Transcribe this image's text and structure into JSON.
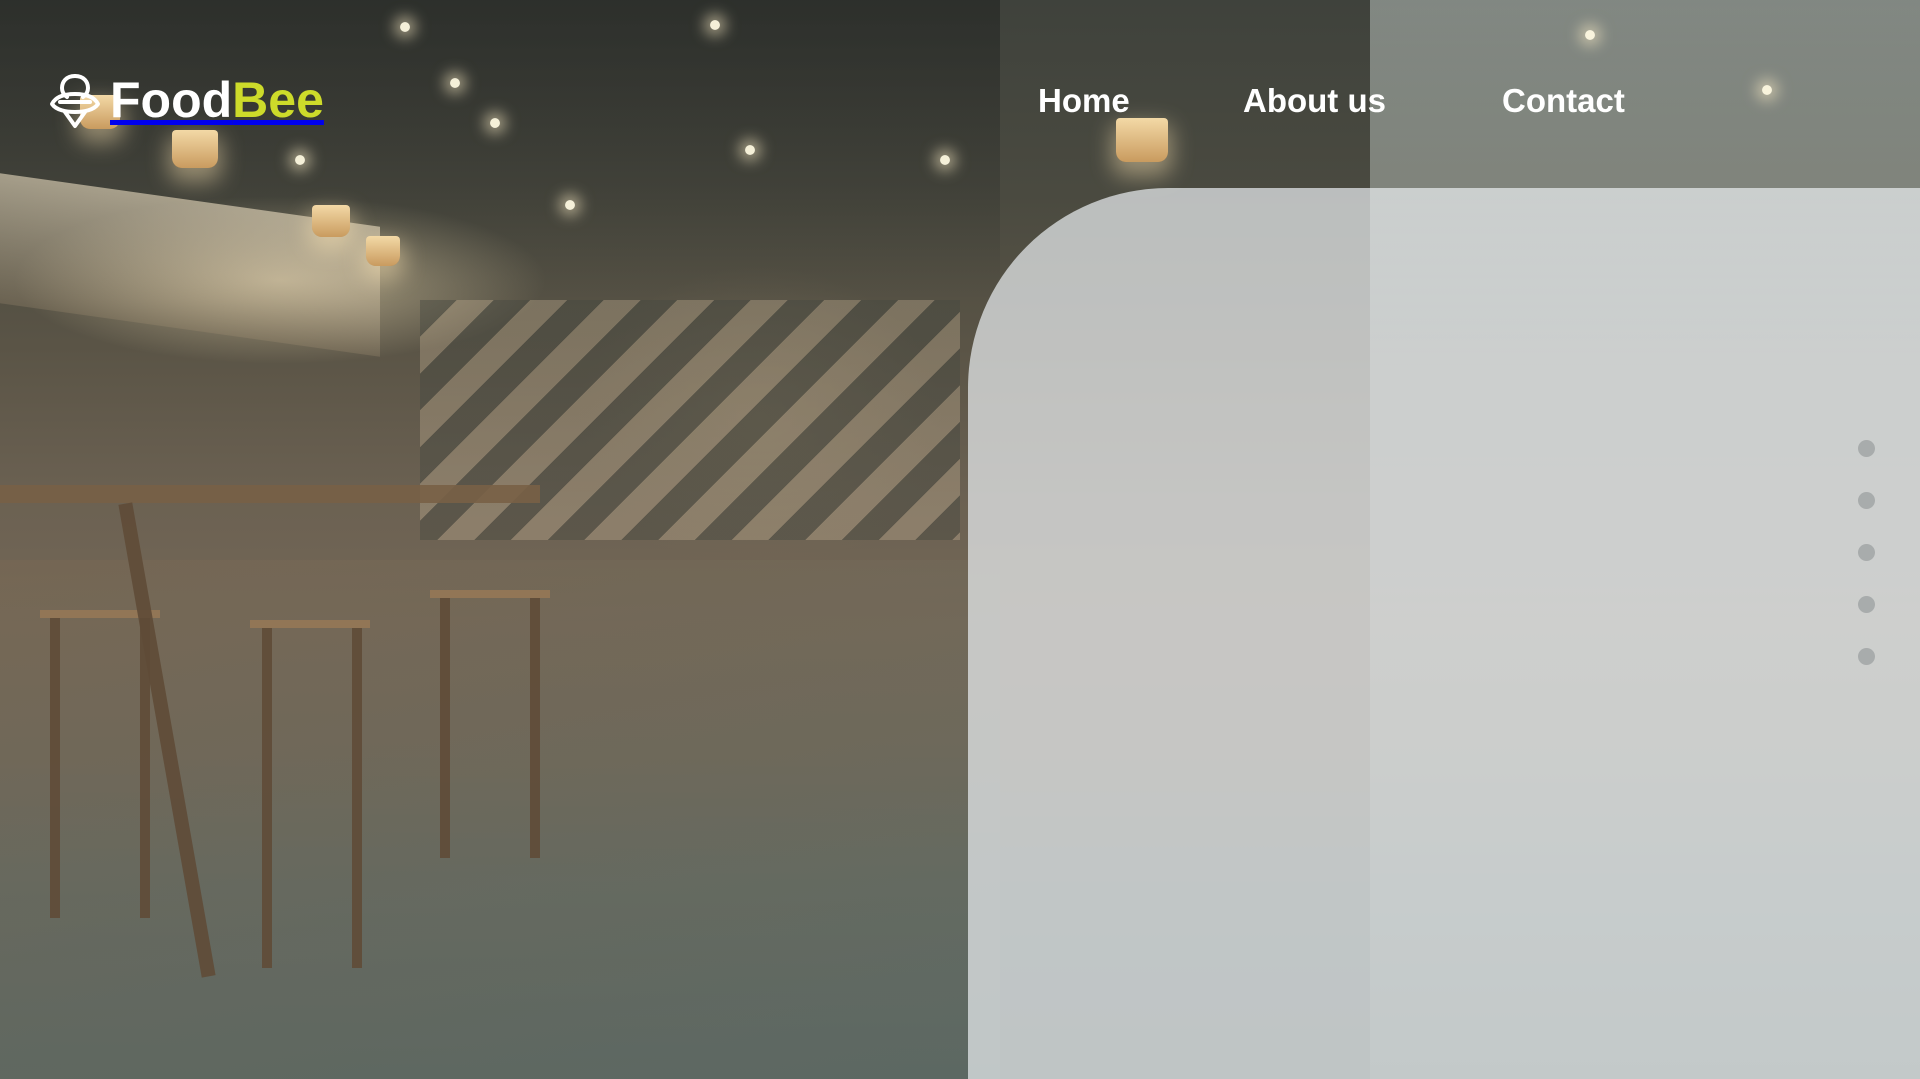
{
  "brand": {
    "name_part1": "Food",
    "name_part2": "Bee",
    "icon": "bee-icon",
    "colors": {
      "primary_text": "#ffffff",
      "accent": "#cddb2a"
    }
  },
  "nav": {
    "items": [
      {
        "label": "Home"
      },
      {
        "label": "About us"
      },
      {
        "label": "Contact"
      }
    ]
  },
  "hero": {
    "background": "restaurant-interior-photo",
    "panel_color": "#e8ecee"
  },
  "carousel": {
    "dot_count": 5,
    "dot_color": "#a8acac"
  }
}
